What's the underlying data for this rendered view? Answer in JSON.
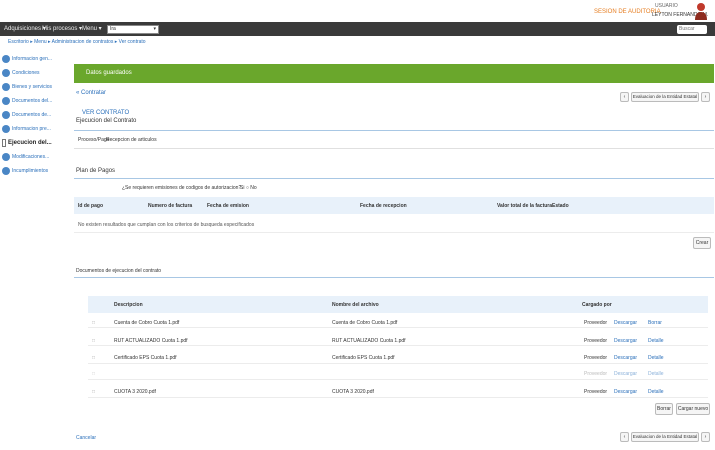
{
  "topbar": {
    "warning": "SESION DE AUDITORIA",
    "user_label": "USUARIO",
    "user_name": "LEYTON FERNANDO M."
  },
  "navbar": {
    "menu": [
      "Adquisiciones ▾",
      "Mis procesos ▾",
      "Menu ▾"
    ],
    "select_value": "Ira",
    "search_placeholder": "Buscar"
  },
  "breadcrumb": "Escritorio ▸ Menu ▸ Administracion de contratos ▸ Ver contrato",
  "sidebar": {
    "items": [
      "Informacion gen...",
      "Condiciones",
      "Bienes y servicios",
      "Documentos del...",
      "Documentos de...",
      "Informacion pre...",
      "Ejecucion del...",
      "Modificaciones...",
      "Incumplimientos"
    ],
    "active_index": 6
  },
  "green_bar": "Datos guardados",
  "back_link": "« Contratar",
  "contract_link": "VER CONTRATO",
  "section_title": "Ejecucion del Contrato",
  "tabs": [
    "Proceso/Pago",
    "Recepcion de articulos"
  ],
  "pager": {
    "prev": "‹",
    "label": "Evaluacion de la Entidad Estatal",
    "next": "›"
  },
  "payment_plan": {
    "title": "Plan de Pagos",
    "question": "¿Se requieren emisiones de codigos de autorizacion?",
    "answer": "Si ○ No",
    "headers": [
      "Id de pago",
      "Numero de factura",
      "Fecha de emision",
      "Fecha de recepcion",
      "Valor total de la factura",
      "Estado"
    ],
    "empty_message": "No existen resultados que cumplan con los criterios de busqueda especificados",
    "create_button": "Crear"
  },
  "documents": {
    "title": "Documentos de ejecucion del contrato",
    "headers": [
      "Descripcion",
      "Nombre del archivo",
      "Cargado por"
    ],
    "rows": [
      {
        "description": "Cuenta de Cobro Cuota 1.pdf",
        "file": "Cuenta de Cobro Cuota 1.pdf",
        "by": "Proveedor",
        "a1": "Descargar",
        "a2": "Borrar"
      },
      {
        "description": "RUT ACTUALIZADO Cuota 1.pdf",
        "file": "RUT ACTUALIZADO Cuota 1.pdf",
        "by": "Proveedor",
        "a1": "Descargar",
        "a2": "Detalle"
      },
      {
        "description": "Certificado EPS Cuota 1.pdf",
        "file": "Certificado EPS Cuota 1.pdf",
        "by": "Proveedor",
        "a1": "Descargar",
        "a2": "Detalle"
      },
      {
        "description": "",
        "file": "",
        "by": "Proveedor",
        "a1": "Descargar",
        "a2": "Detalle"
      },
      {
        "description": "CUOTA 3 2020.pdf",
        "file": "CUOTA 3 2020.pdf",
        "by": "Proveedor",
        "a1": "Descargar",
        "a2": "Detalle"
      }
    ],
    "delete_button": "Borrar",
    "upload_button": "Cargar nuevo"
  },
  "footer_cancel": "Cancelar",
  "colors": {
    "green": "#6aa72c",
    "nav": "#3a3a3a",
    "link": "#2a6fba",
    "warning": "#e67e22"
  }
}
